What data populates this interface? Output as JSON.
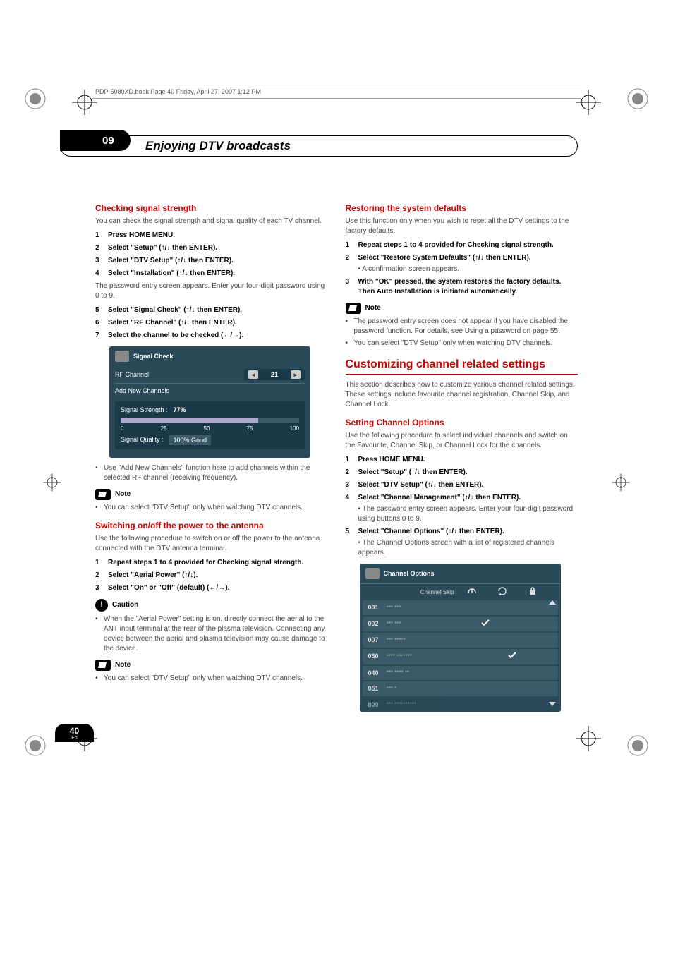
{
  "headerLine": "PDP-5080XD.book  Page 40  Friday, April 27, 2007  1:12 PM",
  "chapterNumber": "09",
  "chapterTitle": "Enjoying DTV broadcasts",
  "left": {
    "h_checking": "Checking signal strength",
    "p_checking": "You can check the signal strength and signal quality of each TV channel.",
    "steps_a": [
      "Press HOME MENU.",
      "Select \"Setup\" (↑/↓ then ENTER).",
      "Select \"DTV Setup\" (↑/↓ then ENTER).",
      "Select \"Installation\" (↑/↓ then ENTER)."
    ],
    "p_password": "The password entry screen appears. Enter your four-digit password using 0 to 9.",
    "steps_b": [
      "Select \"Signal Check\" (↑/↓ then ENTER).",
      "Select \"RF Channel\" (↑/↓ then ENTER).",
      "Select the channel to be checked (←/→)."
    ],
    "signalWidget": {
      "title": "Signal Check",
      "rfLabel": "RF Channel",
      "rfValue": "21",
      "addNew": "Add New Channels",
      "strengthLabel": "Signal Strength  :",
      "strengthValue": "77%",
      "ticks": [
        "0",
        "25",
        "50",
        "75",
        "100"
      ],
      "qualityLabel": "Signal Quality    :",
      "qualityValue": "100%  Good"
    },
    "bullet_addnew": "Use \"Add New Channels\" function here to add channels within the selected RF channel (receiving frequency).",
    "noteLabel": "Note",
    "bullet_dtv1": "You can select \"DTV Setup\" only when watching DTV channels.",
    "h_antenna": "Switching on/off the power to the antenna",
    "p_antenna": "Use the following procedure to switch on or off the power to the antenna connected with the DTV antenna terminal.",
    "steps_c": [
      "Repeat steps 1 to 4 provided for Checking signal strength.",
      "Select \"Aerial Power\" (↑/↓).",
      "Select \"On\" or \"Off\" (default) (←/→)."
    ],
    "cautionLabel": "Caution",
    "bullet_caution": "When the \"Aerial Power\" setting is on, directly connect the aerial to the ANT input terminal at the rear of the plasma television. Connecting any device between the aerial and plasma television may cause damage to the device.",
    "bullet_dtv2": "You can select \"DTV Setup\" only when watching DTV channels."
  },
  "right": {
    "h_restore": "Restoring the system defaults",
    "p_restore": "Use this function only when you wish to reset all the DTV settings to the factory defaults.",
    "steps_d": [
      "Repeat steps 1 to 4 provided for Checking signal strength.",
      "Select \"Restore System Defaults\" (↑/↓ then ENTER)."
    ],
    "sub_confirm": "A confirmation screen appears.",
    "step3_restore": "With \"OK\" pressed, the system restores the factory defaults. Then Auto Installation is initiated automatically.",
    "bullet_pwd": "The password entry screen does not appear if you have disabled the password function. For details, see Using a password on page 55.",
    "bullet_dtv3": "You can select \"DTV Setup\" only when watching DTV channels.",
    "h_customizing": "Customizing channel related settings",
    "p_customizing": "This section describes how to customize various channel related settings. These settings include favourite channel registration, Channel Skip, and Channel Lock.",
    "h_setting": "Setting Channel Options",
    "p_setting": "Use the following procedure to select individual channels and switch on the Favourite, Channel Skip, or Channel Lock for the channels.",
    "steps_e": [
      "Press HOME MENU.",
      "Select \"Setup\" (↑/↓ then ENTER).",
      "Select \"DTV Setup\" (↑/↓ then ENTER).",
      "Select \"Channel Management\" (↑/↓ then ENTER)."
    ],
    "sub_pwd": "The password entry screen appears. Enter your four-digit password using buttons 0 to 9.",
    "step5_chopt": "Select \"Channel Options\" (↑/↓ then ENTER).",
    "sub_chopt": "The Channel Options screen with a list of registered channels appears.",
    "channelWidget": {
      "title": "Channel Options",
      "colSkip": "Channel Skip",
      "rows": [
        {
          "num": "001",
          "name": "*** ***",
          "fav": false,
          "skip": false
        },
        {
          "num": "002",
          "name": "*** ***",
          "fav": true,
          "skip": false
        },
        {
          "num": "007",
          "name": "*** *****",
          "fav": false,
          "skip": false
        },
        {
          "num": "030",
          "name": "**** *******",
          "fav": false,
          "skip": true
        },
        {
          "num": "040",
          "name": "*** **** **",
          "fav": false,
          "skip": false
        },
        {
          "num": "051",
          "name": "*** *",
          "fav": false,
          "skip": false
        },
        {
          "num": "800",
          "name": "*** **********",
          "fav": false,
          "skip": false
        }
      ]
    }
  },
  "pageNumber": "40",
  "pageLang": "En"
}
